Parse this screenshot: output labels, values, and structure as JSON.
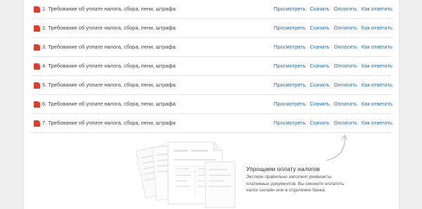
{
  "documents": [
    {
      "title": "1. Требование об уплате налога, сбора, пени, штрафа"
    },
    {
      "title": "2. Требование об уплате налога, сбора, пени, штрафа"
    },
    {
      "title": "3. Требование об уплате налога, сбора, пени, штрафа"
    },
    {
      "title": "4. Требование об уплате налога, сбора, пени, штрафа"
    },
    {
      "title": "5. Требование об уплате налога, сбора, пени, штрафа"
    },
    {
      "title": "6. Требование об уплате налога, сбора, пени, штрафа"
    },
    {
      "title": "7. Требование об уплате налога, сбора, пени, штрафа"
    }
  ],
  "actions": {
    "view": "Просмотреть",
    "download": "Скачать",
    "pay": "Оплатить",
    "answer": "Как ответить"
  },
  "promo": {
    "title": "Упрощаем оплату налогов",
    "text": "Экстерн правильно заполнит реквизиты платежных документов. Вы сможете оплатить налог онлайн или в отделении банка.",
    "arrow_icon": "curved-arrow-icon",
    "illustration": "payment-documents-illustration"
  },
  "colors": {
    "link": "#1a73c9",
    "pdf_icon": "#d9412e",
    "background": "#efefef",
    "panel": "#ffffff"
  }
}
